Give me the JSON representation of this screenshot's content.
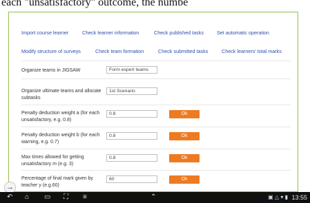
{
  "top_text": "each \"unsatisfactory\" outcome, the numbe",
  "nav": {
    "row1": [
      "Import course learner",
      "Check learner information",
      "Check published tasks",
      "Set automatic operation"
    ],
    "row2": [
      "Modify structure of surveys",
      "Check team formation",
      "Check submitted tasks",
      "Check learners' total marks"
    ]
  },
  "form": {
    "organize_label": "Organize teams in JIGSAW",
    "organize_value": "Form expert teams",
    "ultimate_label": "Organize ultimate teams and allocate subtasks",
    "ultimate_value": "1st Scenario",
    "penalty_a_label": "Penalty deduction weight a (for each unsatisfactory, e.g. 0.8)",
    "penalty_a_value": "0.8",
    "penalty_b_label": "Penalty deduction weight b (for each warning, e.g. 0.7)",
    "penalty_b_value": "0.8",
    "max_times_label": "Max times allowed for getting unsatisfactory m (e.g. 3)",
    "max_times_value": "0.8",
    "percentage_label": "Percentage of final mark given by teacher y (e.g.60)",
    "percentage_value": "60",
    "ok_label": "Ok"
  },
  "system_bar": {
    "clock": "13:55"
  },
  "colors": {
    "accent_orange": "#ee7a22",
    "link_blue": "#2f4fa8",
    "frame_green": "#8fc04a",
    "system_bar": "#101010"
  }
}
